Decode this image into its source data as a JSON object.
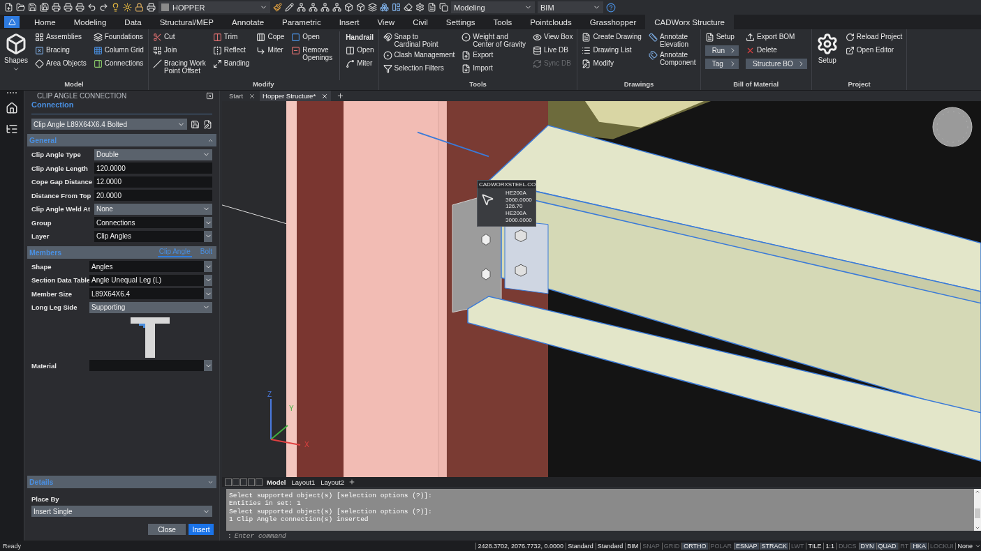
{
  "quick_access": {
    "layer": "HOPPER",
    "workspace": "Modeling",
    "profile": "BIM"
  },
  "ribbon_tabs": [
    {
      "label": "Home",
      "selected": false
    },
    {
      "label": "Modeling",
      "selected": false
    },
    {
      "label": "Data",
      "selected": false
    },
    {
      "label": "Structural/MEP",
      "selected": false
    },
    {
      "label": "Annotate",
      "selected": false
    },
    {
      "label": "Parametric",
      "selected": false
    },
    {
      "label": "Insert",
      "selected": false
    },
    {
      "label": "View",
      "selected": false
    },
    {
      "label": "Civil",
      "selected": false
    },
    {
      "label": "Settings",
      "selected": false
    },
    {
      "label": "Tools",
      "selected": false
    },
    {
      "label": "Pointclouds",
      "selected": false
    },
    {
      "label": "Grasshopper",
      "selected": false
    },
    {
      "label": "CADWorx Structure",
      "selected": true
    }
  ],
  "ribbon_groups": [
    {
      "title": "Model",
      "columns": [
        [
          {
            "label": "Shapes",
            "kind": "large",
            "disabled": false
          }
        ],
        [
          {
            "label": "Assemblies",
            "kind": "small",
            "disabled": false
          },
          {
            "label": "Bracing",
            "kind": "small",
            "disabled": false
          },
          {
            "label": "Area Objects",
            "kind": "small",
            "disabled": false
          }
        ],
        [
          {
            "label": "Foundations",
            "kind": "small",
            "disabled": false
          },
          {
            "label": "Column Grid",
            "kind": "small",
            "disabled": false
          },
          {
            "label": "Connections",
            "kind": "small",
            "disabled": false
          }
        ]
      ]
    },
    {
      "title": "Modify",
      "columns": [
        [
          {
            "label": "Cut",
            "kind": "small",
            "disabled": false
          },
          {
            "label": "Join",
            "kind": "small",
            "disabled": false
          },
          {
            "label": "Bracing Work\nPoint Offset",
            "kind": "small",
            "disabled": false
          }
        ],
        [
          {
            "label": "Trim",
            "kind": "small",
            "disabled": false
          },
          {
            "label": "Reflect",
            "kind": "small",
            "disabled": false
          },
          {
            "label": "Banding",
            "kind": "small",
            "disabled": false
          }
        ],
        [
          {
            "label": "Cope",
            "kind": "small",
            "disabled": false
          },
          {
            "label": "Miter",
            "kind": "small",
            "disabled": false
          }
        ],
        [
          {
            "label": "Open",
            "kind": "small",
            "disabled": false
          },
          {
            "label": "Remove\nOpenings",
            "kind": "small",
            "disabled": false
          }
        ],
        [
          {
            "label": "Handrail",
            "kind": "heading",
            "disabled": false
          },
          {
            "label": "Open",
            "kind": "small",
            "disabled": false
          },
          {
            "label": "Miter",
            "kind": "small",
            "disabled": false
          }
        ]
      ]
    },
    {
      "title": "Tools",
      "columns": [
        [
          {
            "label": "Snap to\nCardinal Point",
            "kind": "small",
            "disabled": false
          },
          {
            "label": "Clash Management",
            "kind": "small",
            "disabled": false
          },
          {
            "label": "Selection Filters",
            "kind": "small",
            "disabled": false
          }
        ],
        [
          {
            "label": "Weight and\nCenter of Gravity",
            "kind": "small",
            "disabled": false
          },
          {
            "label": "Export",
            "kind": "small",
            "disabled": false
          },
          {
            "label": "Import",
            "kind": "small",
            "disabled": false
          }
        ],
        [
          {
            "label": "View Box",
            "kind": "small",
            "disabled": false
          },
          {
            "label": "Live DB",
            "kind": "small",
            "disabled": false
          },
          {
            "label": "Sync DB",
            "kind": "small",
            "disabled": true
          }
        ]
      ]
    },
    {
      "title": "Drawings",
      "columns": [
        [
          {
            "label": "Create Drawing",
            "kind": "small",
            "disabled": false
          },
          {
            "label": "Drawing List",
            "kind": "small",
            "disabled": false
          },
          {
            "label": "Modify",
            "kind": "small",
            "disabled": false
          }
        ],
        [
          {
            "label": "Annotate\nElevation",
            "kind": "small",
            "disabled": false
          },
          {
            "label": "Annotate\nComponent",
            "kind": "small",
            "disabled": false
          }
        ]
      ]
    },
    {
      "title": "Bill of Material",
      "columns": [
        [
          {
            "label": "Setup",
            "kind": "small",
            "disabled": false
          },
          {
            "label": "Run",
            "kind": "menu",
            "disabled": false
          },
          {
            "label": "Tag",
            "kind": "menu",
            "disabled": false
          }
        ],
        [
          {
            "label": "Export BOM",
            "kind": "small",
            "disabled": false
          },
          {
            "label": "Delete",
            "kind": "small",
            "disabled": false
          },
          {
            "label": "Structure BO",
            "kind": "menu",
            "disabled": false
          }
        ]
      ]
    },
    {
      "title": "Project",
      "columns": [
        [
          {
            "label": "Setup",
            "kind": "large",
            "disabled": false
          }
        ],
        [
          {
            "label": "Reload Project",
            "kind": "small",
            "disabled": false
          },
          {
            "label": "Open Editor",
            "kind": "small",
            "disabled": false
          }
        ]
      ]
    }
  ],
  "properties": {
    "title": "CLIP ANGLE CONNECTION",
    "section": "Connection",
    "preset": "Clip Angle L89X64X6.4 Bolted",
    "general": {
      "title": "General",
      "expanded": true,
      "rows": [
        {
          "label": "Clip Angle Type",
          "value": "Double",
          "kind": "select"
        },
        {
          "label": "Clip Angle Length",
          "value": "120.0000",
          "kind": "input"
        },
        {
          "label": "Cope Gap Distance",
          "value": "12.0000",
          "kind": "input"
        },
        {
          "label": "Distance From Top",
          "value": "20.0000",
          "kind": "input"
        },
        {
          "label": "Clip Angle Weld At",
          "value": "None",
          "kind": "select"
        },
        {
          "label": "Group",
          "value": "Connections",
          "kind": "combo"
        },
        {
          "label": "Layer",
          "value": "Clip Angles",
          "kind": "combo"
        }
      ]
    },
    "members": {
      "title": "Members",
      "tabs": [
        {
          "label": "Clip Angle",
          "selected": true
        },
        {
          "label": "Bolt",
          "selected": false
        }
      ],
      "rows": [
        {
          "label": "Shape",
          "value": "Angles",
          "kind": "combo"
        },
        {
          "label": "Section Data Table",
          "value": "Angle Unequal Leg (L)",
          "kind": "combo"
        },
        {
          "label": "Member Size",
          "value": "L89X64X6.4",
          "kind": "combo"
        },
        {
          "label": "Long Leg Side",
          "value": "Supporting",
          "kind": "select"
        }
      ],
      "extra_rows": [
        {
          "label": "Material",
          "kind": "combo"
        }
      ]
    },
    "details": {
      "title": "Details",
      "expanded": false,
      "place_by_label": "Place By",
      "place_by": "Insert Single"
    },
    "buttons": [
      {
        "label": "Close",
        "primary": false
      },
      {
        "label": "Insert",
        "primary": true
      }
    ]
  },
  "doc_tabs": [
    {
      "label": "Start",
      "selected": false
    },
    {
      "label": "Hopper Structure*",
      "selected": true
    }
  ],
  "viewport": {
    "tooltip": {
      "title": "CADWORXSTEEL.CO",
      "lines": [
        "HE200A",
        "3000.0000",
        "126.70",
        "HE200A",
        "3000.0000"
      ]
    },
    "axis_labels": [
      "Z",
      "Y",
      "X"
    ]
  },
  "layout_tabs": [
    {
      "label": "Model",
      "selected": true
    },
    {
      "label": "Layout1",
      "selected": false
    },
    {
      "label": "Layout2",
      "selected": false
    }
  ],
  "command": {
    "history": [
      "Select supported object(s) [selection options (?)]:",
      "Entities in set: 1",
      "Select supported object(s) [selection options (?)]:",
      "1 Clip Angle connection(s) inserted"
    ],
    "prompt": ":",
    "placeholder": "Enter command"
  },
  "status_bar": {
    "message": "Ready",
    "coordinates": "2428.3702, 2076.7732, 0.0000",
    "items": [
      {
        "label": "Standard",
        "kind": "text",
        "on": true
      },
      {
        "label": "Standard",
        "kind": "text",
        "on": true
      },
      {
        "label": "BIM",
        "kind": "text",
        "on": true
      },
      {
        "label": "SNAP",
        "kind": "toggle",
        "on": false
      },
      {
        "label": "GRID",
        "kind": "toggle",
        "on": false
      },
      {
        "label": "ORTHO",
        "kind": "toggle",
        "on": true
      },
      {
        "label": "POLAR",
        "kind": "toggle",
        "on": false
      },
      {
        "label": "ESNAP",
        "kind": "toggle",
        "on": true
      },
      {
        "label": "STRACK",
        "kind": "toggle",
        "on": true
      },
      {
        "label": "LWT",
        "kind": "toggle",
        "on": false
      },
      {
        "label": "TILE",
        "kind": "text",
        "on": true
      },
      {
        "label": "1:1",
        "kind": "text",
        "on": true
      },
      {
        "label": "DUCS",
        "kind": "toggle",
        "on": false
      },
      {
        "label": "DYN",
        "kind": "toggle",
        "on": true
      },
      {
        "label": "QUAD",
        "kind": "toggle",
        "on": true
      },
      {
        "label": "RT",
        "kind": "toggle",
        "on": false
      },
      {
        "label": "HKA",
        "kind": "toggle",
        "on": true
      },
      {
        "label": "LOCKUI",
        "kind": "toggle",
        "on": false
      },
      {
        "label": "None",
        "kind": "text",
        "on": true
      }
    ]
  }
}
